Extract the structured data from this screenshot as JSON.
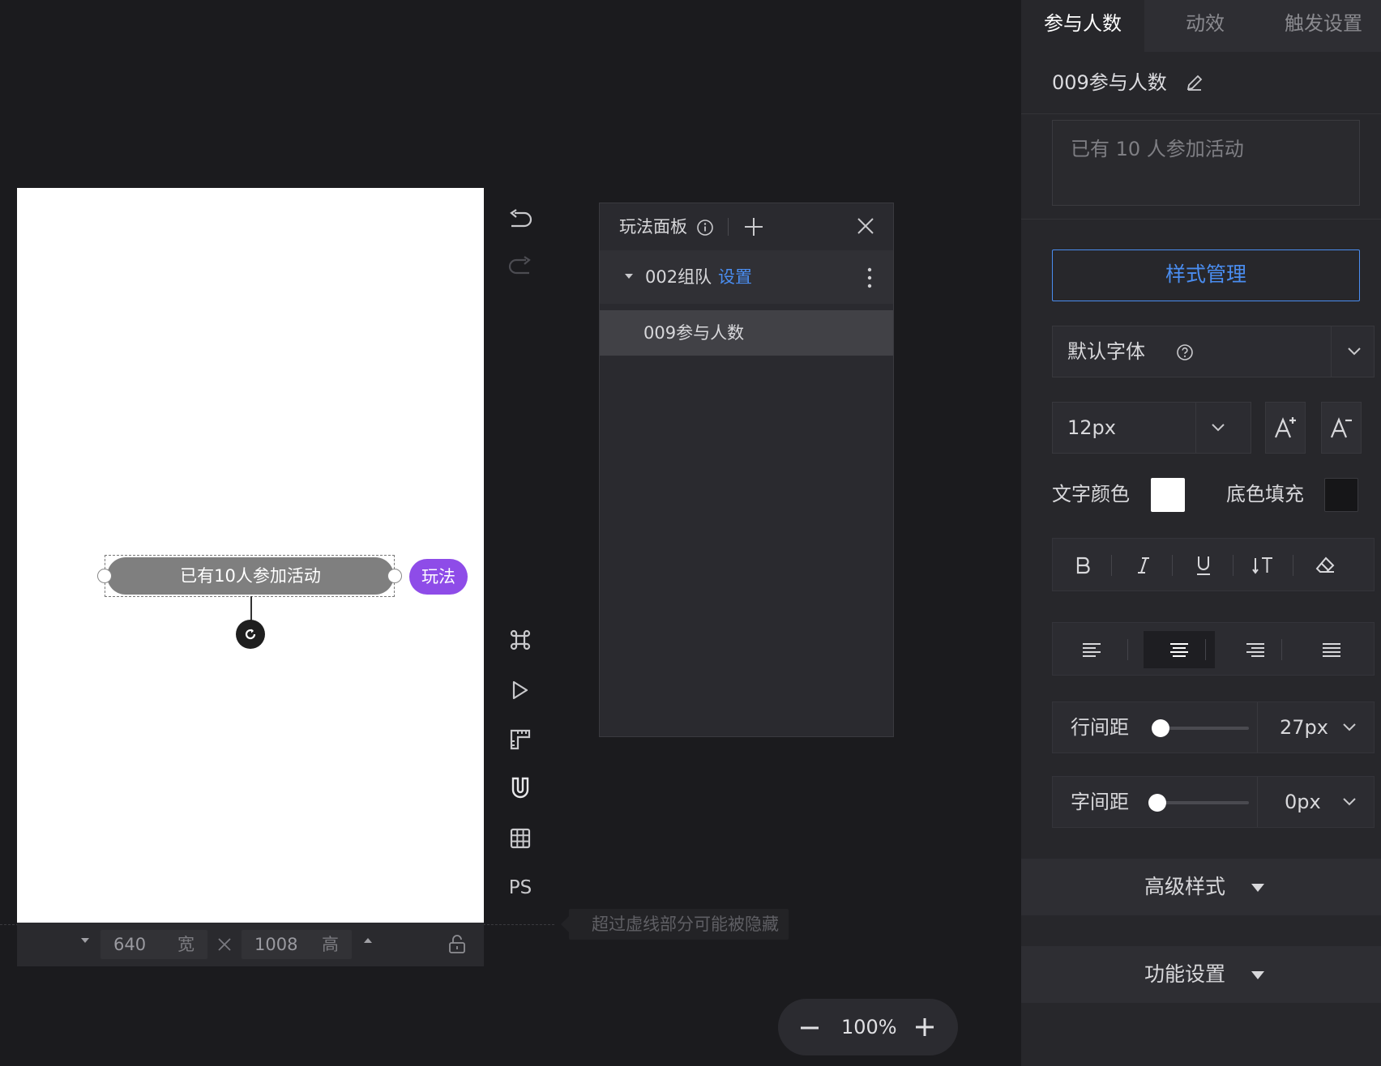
{
  "canvas": {
    "element_text": "已有10人参加活动",
    "play_tag": "玩法",
    "width_value": "640",
    "width_unit": "宽",
    "height_value": "1008",
    "height_unit": "高",
    "overflow_hint": "超过虚线部分可能被隐藏"
  },
  "toolbar": {
    "icons": [
      "undo-icon",
      "redo-icon",
      "command-icon",
      "play-icon",
      "ruler-icon",
      "magnet-icon",
      "grid-icon"
    ],
    "ps_label": "PS"
  },
  "gameplay_panel": {
    "title": "玩法面板",
    "group_label": "002组队",
    "group_link": "设置",
    "item_label": "009参与人数"
  },
  "zoom": {
    "value": "100%"
  },
  "properties": {
    "tabs": [
      "参与人数",
      "动效",
      "触发设置"
    ],
    "active_tab": "参与人数",
    "component_name": "009参与人数",
    "text_content": "已有 10 人参加活动",
    "style_manage_label": "样式管理",
    "font_family": "默认字体",
    "font_size": "12px",
    "text_color_label": "文字颜色",
    "text_color": "#ffffff",
    "bg_fill_label": "底色填充",
    "bg_fill_color": "#161618",
    "active_align": "center",
    "line_height_label": "行间距",
    "line_height_value": "27px",
    "letter_spacing_label": "字间距",
    "letter_spacing_value": "0px",
    "advanced_label": "高级样式",
    "function_label": "功能设置"
  },
  "colors": {
    "accent": "#4a8df0",
    "play_tag": "#8e4ce8"
  }
}
